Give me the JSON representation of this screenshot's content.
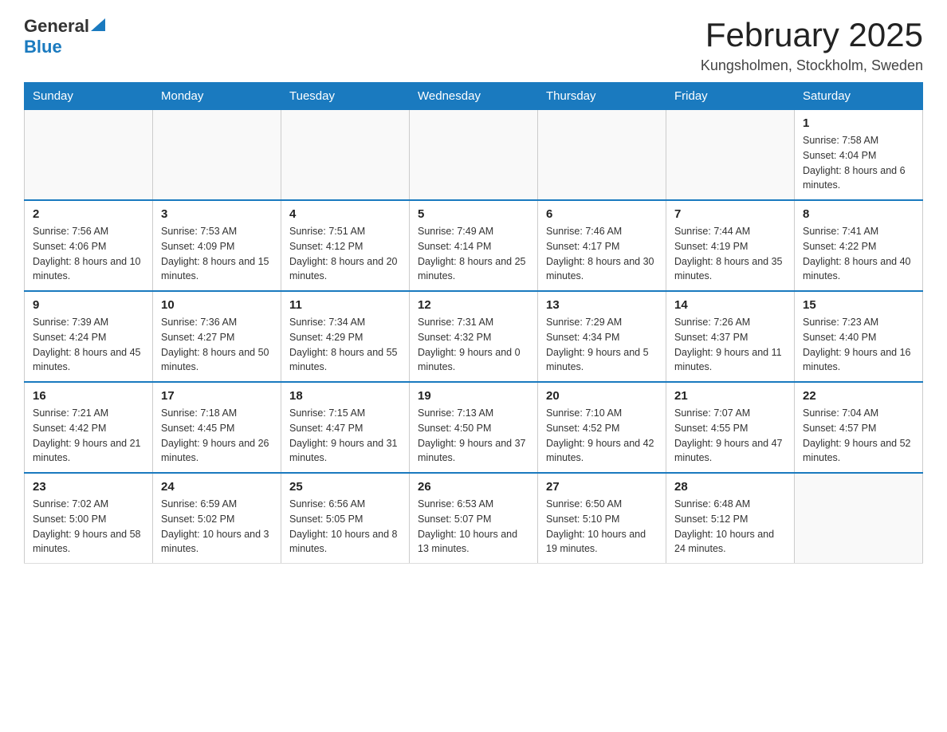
{
  "header": {
    "logo_general": "General",
    "logo_blue": "Blue",
    "month_title": "February 2025",
    "location": "Kungsholmen, Stockholm, Sweden"
  },
  "weekdays": [
    "Sunday",
    "Monday",
    "Tuesday",
    "Wednesday",
    "Thursday",
    "Friday",
    "Saturday"
  ],
  "weeks": [
    [
      {
        "day": "",
        "info": ""
      },
      {
        "day": "",
        "info": ""
      },
      {
        "day": "",
        "info": ""
      },
      {
        "day": "",
        "info": ""
      },
      {
        "day": "",
        "info": ""
      },
      {
        "day": "",
        "info": ""
      },
      {
        "day": "1",
        "info": "Sunrise: 7:58 AM\nSunset: 4:04 PM\nDaylight: 8 hours and 6 minutes."
      }
    ],
    [
      {
        "day": "2",
        "info": "Sunrise: 7:56 AM\nSunset: 4:06 PM\nDaylight: 8 hours and 10 minutes."
      },
      {
        "day": "3",
        "info": "Sunrise: 7:53 AM\nSunset: 4:09 PM\nDaylight: 8 hours and 15 minutes."
      },
      {
        "day": "4",
        "info": "Sunrise: 7:51 AM\nSunset: 4:12 PM\nDaylight: 8 hours and 20 minutes."
      },
      {
        "day": "5",
        "info": "Sunrise: 7:49 AM\nSunset: 4:14 PM\nDaylight: 8 hours and 25 minutes."
      },
      {
        "day": "6",
        "info": "Sunrise: 7:46 AM\nSunset: 4:17 PM\nDaylight: 8 hours and 30 minutes."
      },
      {
        "day": "7",
        "info": "Sunrise: 7:44 AM\nSunset: 4:19 PM\nDaylight: 8 hours and 35 minutes."
      },
      {
        "day": "8",
        "info": "Sunrise: 7:41 AM\nSunset: 4:22 PM\nDaylight: 8 hours and 40 minutes."
      }
    ],
    [
      {
        "day": "9",
        "info": "Sunrise: 7:39 AM\nSunset: 4:24 PM\nDaylight: 8 hours and 45 minutes."
      },
      {
        "day": "10",
        "info": "Sunrise: 7:36 AM\nSunset: 4:27 PM\nDaylight: 8 hours and 50 minutes."
      },
      {
        "day": "11",
        "info": "Sunrise: 7:34 AM\nSunset: 4:29 PM\nDaylight: 8 hours and 55 minutes."
      },
      {
        "day": "12",
        "info": "Sunrise: 7:31 AM\nSunset: 4:32 PM\nDaylight: 9 hours and 0 minutes."
      },
      {
        "day": "13",
        "info": "Sunrise: 7:29 AM\nSunset: 4:34 PM\nDaylight: 9 hours and 5 minutes."
      },
      {
        "day": "14",
        "info": "Sunrise: 7:26 AM\nSunset: 4:37 PM\nDaylight: 9 hours and 11 minutes."
      },
      {
        "day": "15",
        "info": "Sunrise: 7:23 AM\nSunset: 4:40 PM\nDaylight: 9 hours and 16 minutes."
      }
    ],
    [
      {
        "day": "16",
        "info": "Sunrise: 7:21 AM\nSunset: 4:42 PM\nDaylight: 9 hours and 21 minutes."
      },
      {
        "day": "17",
        "info": "Sunrise: 7:18 AM\nSunset: 4:45 PM\nDaylight: 9 hours and 26 minutes."
      },
      {
        "day": "18",
        "info": "Sunrise: 7:15 AM\nSunset: 4:47 PM\nDaylight: 9 hours and 31 minutes."
      },
      {
        "day": "19",
        "info": "Sunrise: 7:13 AM\nSunset: 4:50 PM\nDaylight: 9 hours and 37 minutes."
      },
      {
        "day": "20",
        "info": "Sunrise: 7:10 AM\nSunset: 4:52 PM\nDaylight: 9 hours and 42 minutes."
      },
      {
        "day": "21",
        "info": "Sunrise: 7:07 AM\nSunset: 4:55 PM\nDaylight: 9 hours and 47 minutes."
      },
      {
        "day": "22",
        "info": "Sunrise: 7:04 AM\nSunset: 4:57 PM\nDaylight: 9 hours and 52 minutes."
      }
    ],
    [
      {
        "day": "23",
        "info": "Sunrise: 7:02 AM\nSunset: 5:00 PM\nDaylight: 9 hours and 58 minutes."
      },
      {
        "day": "24",
        "info": "Sunrise: 6:59 AM\nSunset: 5:02 PM\nDaylight: 10 hours and 3 minutes."
      },
      {
        "day": "25",
        "info": "Sunrise: 6:56 AM\nSunset: 5:05 PM\nDaylight: 10 hours and 8 minutes."
      },
      {
        "day": "26",
        "info": "Sunrise: 6:53 AM\nSunset: 5:07 PM\nDaylight: 10 hours and 13 minutes."
      },
      {
        "day": "27",
        "info": "Sunrise: 6:50 AM\nSunset: 5:10 PM\nDaylight: 10 hours and 19 minutes."
      },
      {
        "day": "28",
        "info": "Sunrise: 6:48 AM\nSunset: 5:12 PM\nDaylight: 10 hours and 24 minutes."
      },
      {
        "day": "",
        "info": ""
      }
    ]
  ]
}
